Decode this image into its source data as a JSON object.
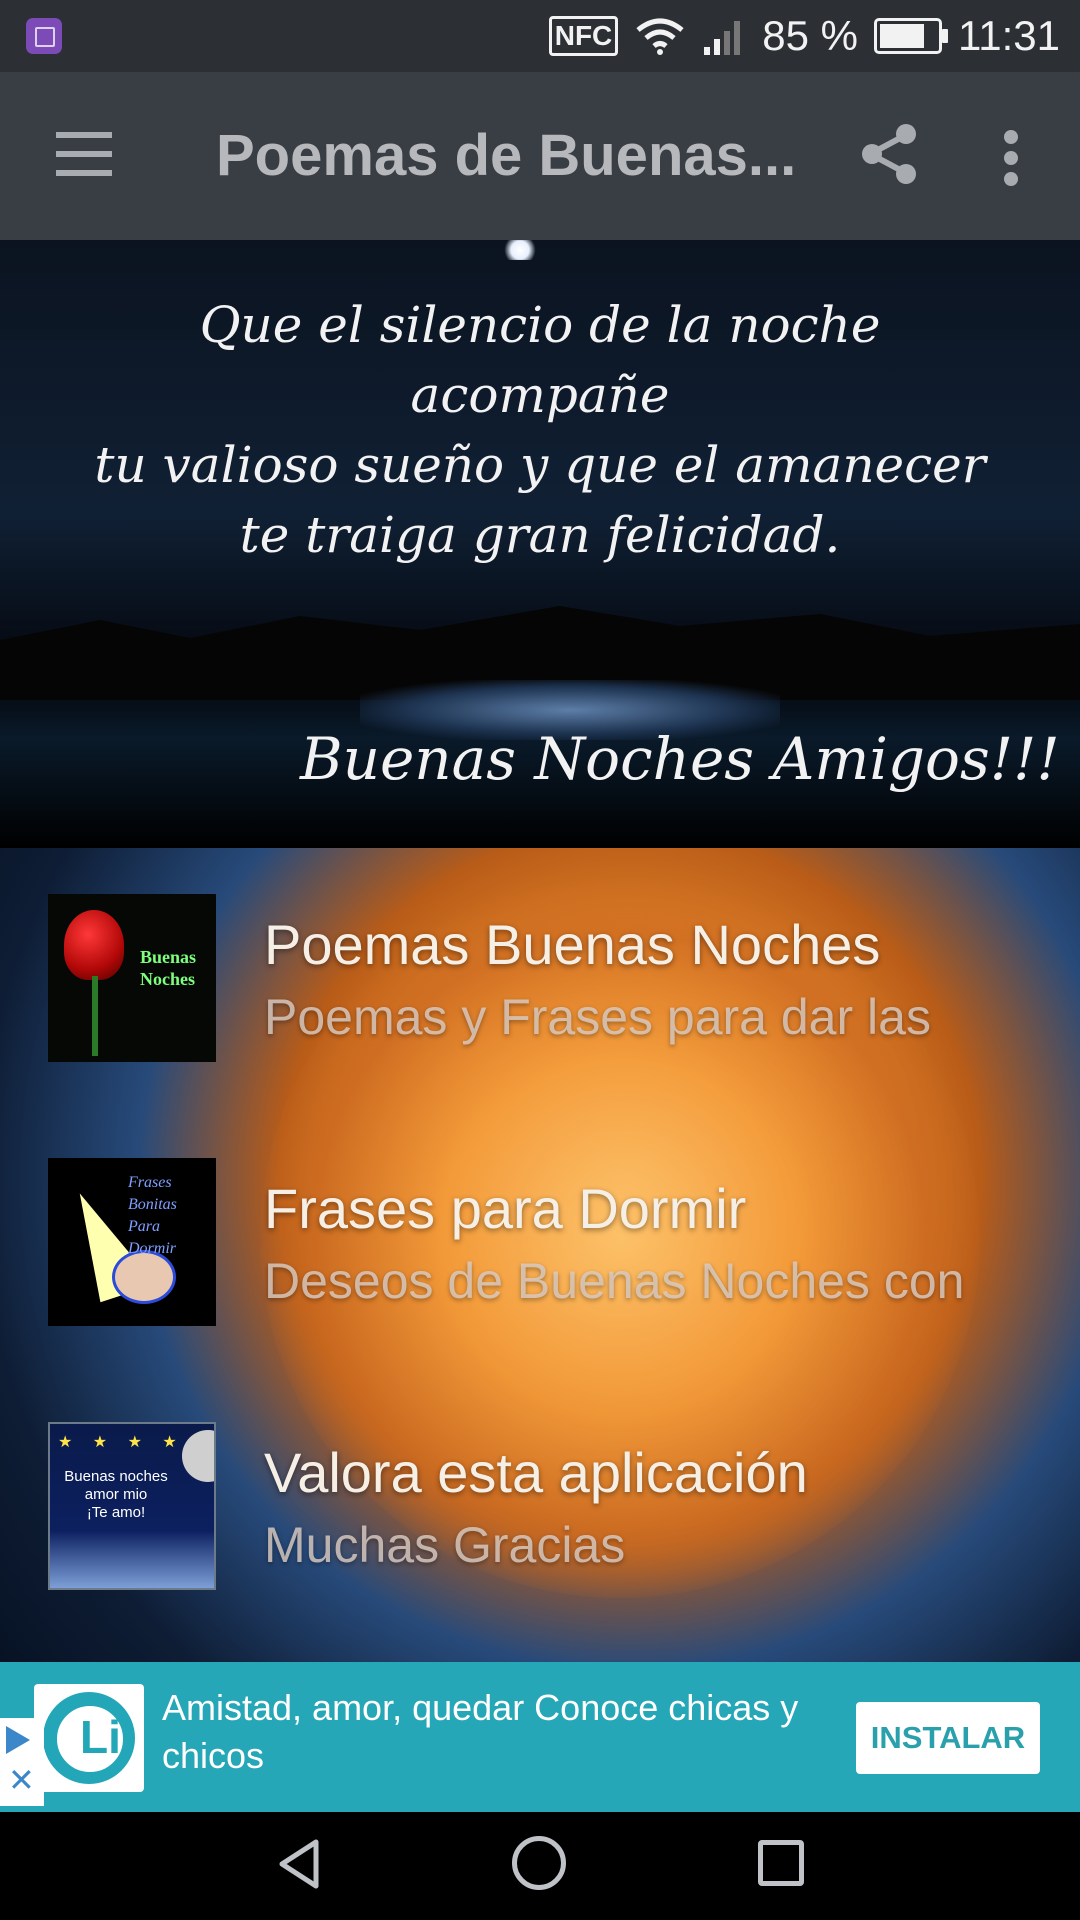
{
  "status_bar": {
    "nfc": "NFC",
    "battery_percent": "85 %",
    "time": "11:31"
  },
  "toolbar": {
    "title": "Poemas de Buenas..."
  },
  "header_image": {
    "quote_lines": [
      "Que el silencio de la noche  acompañe",
      "tu valioso sueño y que el amanecer",
      "te traiga gran felicidad."
    ],
    "signature": "Buenas Noches  Amigos!!!"
  },
  "list_items": [
    {
      "title": "Poemas Buenas Noches",
      "subtitle": "Poemas y Frases para dar las",
      "thumb_text": [
        "Buenas",
        "Noches"
      ]
    },
    {
      "title": "Frases para Dormir",
      "subtitle": "Deseos de Buenas Noches con",
      "thumb_text": [
        "Frases",
        "Bonitas",
        "Para",
        "Dormir"
      ]
    },
    {
      "title": "Valora esta aplicación",
      "subtitle": "Muchas Gracias",
      "thumb_text": [
        "Buenas noches",
        "amor mio",
        "¡Te amo!"
      ]
    }
  ],
  "ad": {
    "text": "Amistad, amor, quedar Conoce chicas y chicos",
    "button_label": "INSTALAR",
    "logo_letter": "Li",
    "close": "✕"
  },
  "colors": {
    "status_bar": "#2c3035",
    "toolbar": "#393d44",
    "ad_banner": "#26a7b7"
  }
}
